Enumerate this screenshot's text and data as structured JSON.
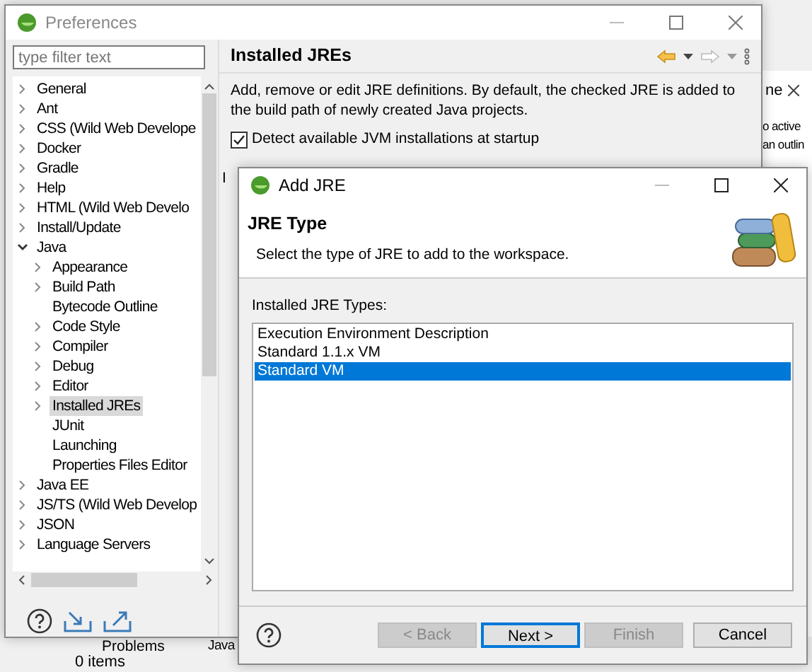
{
  "background_app": {
    "tab_label": "ne",
    "texts": [
      "o active",
      "an outlin"
    ],
    "bottom_tabs": [
      "Problems",
      "Java"
    ],
    "status": "0 items",
    "hidden_label": "I"
  },
  "preferences": {
    "title": "Preferences",
    "filter": {
      "placeholder": "type filter text"
    },
    "tree": [
      {
        "label": "General",
        "kind": "group",
        "expanded": false,
        "selected": false
      },
      {
        "label": "Ant",
        "kind": "group",
        "expanded": false,
        "selected": false
      },
      {
        "label": "CSS (Wild Web Develope",
        "kind": "group",
        "expanded": false,
        "selected": false
      },
      {
        "label": "Docker",
        "kind": "group",
        "expanded": false,
        "selected": false
      },
      {
        "label": "Gradle",
        "kind": "group",
        "expanded": false,
        "selected": false
      },
      {
        "label": "Help",
        "kind": "group",
        "expanded": false,
        "selected": false
      },
      {
        "label": "HTML (Wild Web Develo",
        "kind": "group",
        "expanded": false,
        "selected": false
      },
      {
        "label": "Install/Update",
        "kind": "group",
        "expanded": false,
        "selected": false
      },
      {
        "label": "Java",
        "kind": "group",
        "expanded": true,
        "selected": false,
        "children": [
          {
            "label": "Appearance",
            "kind": "group",
            "expanded": false,
            "selected": false
          },
          {
            "label": "Build Path",
            "kind": "group",
            "expanded": false,
            "selected": false
          },
          {
            "label": "Bytecode Outline",
            "kind": "leaf",
            "selected": false
          },
          {
            "label": "Code Style",
            "kind": "group",
            "expanded": false,
            "selected": false
          },
          {
            "label": "Compiler",
            "kind": "group",
            "expanded": false,
            "selected": false
          },
          {
            "label": "Debug",
            "kind": "group",
            "expanded": false,
            "selected": false
          },
          {
            "label": "Editor",
            "kind": "group",
            "expanded": false,
            "selected": false
          },
          {
            "label": "Installed JREs",
            "kind": "group",
            "expanded": false,
            "selected": true
          },
          {
            "label": "JUnit",
            "kind": "leaf",
            "selected": false
          },
          {
            "label": "Launching",
            "kind": "leaf",
            "selected": false
          },
          {
            "label": "Properties Files Editor",
            "kind": "leaf",
            "selected": false
          }
        ]
      },
      {
        "label": "Java EE",
        "kind": "group",
        "expanded": false,
        "selected": false
      },
      {
        "label": "JS/TS (Wild Web Develop",
        "kind": "group",
        "expanded": false,
        "selected": false
      },
      {
        "label": "JSON",
        "kind": "group",
        "expanded": false,
        "selected": false
      },
      {
        "label": "Language Servers",
        "kind": "group",
        "expanded": false,
        "selected": false
      }
    ],
    "page_title": "Installed JREs",
    "description": "Add, remove or edit JRE definitions. By default, the checked JRE is added to the build path of newly created Java projects.",
    "detect_checkbox": {
      "label": "Detect available JVM installations at startup",
      "checked": true
    }
  },
  "add_jre": {
    "title": "Add JRE",
    "heading": "JRE Type",
    "subtitle": "Select the type of JRE to add to the workspace.",
    "list_label": "Installed JRE Types:",
    "types": [
      {
        "label": "Execution Environment Description",
        "selected": false
      },
      {
        "label": "Standard 1.1.x VM",
        "selected": false
      },
      {
        "label": "Standard VM",
        "selected": true
      }
    ],
    "buttons": [
      {
        "label": "< Back",
        "disabled": true,
        "default": false
      },
      {
        "label": "Next >",
        "disabled": false,
        "default": true
      },
      {
        "label": "Finish",
        "disabled": true,
        "default": false
      },
      {
        "label": "Cancel",
        "disabled": false,
        "default": false
      }
    ]
  }
}
